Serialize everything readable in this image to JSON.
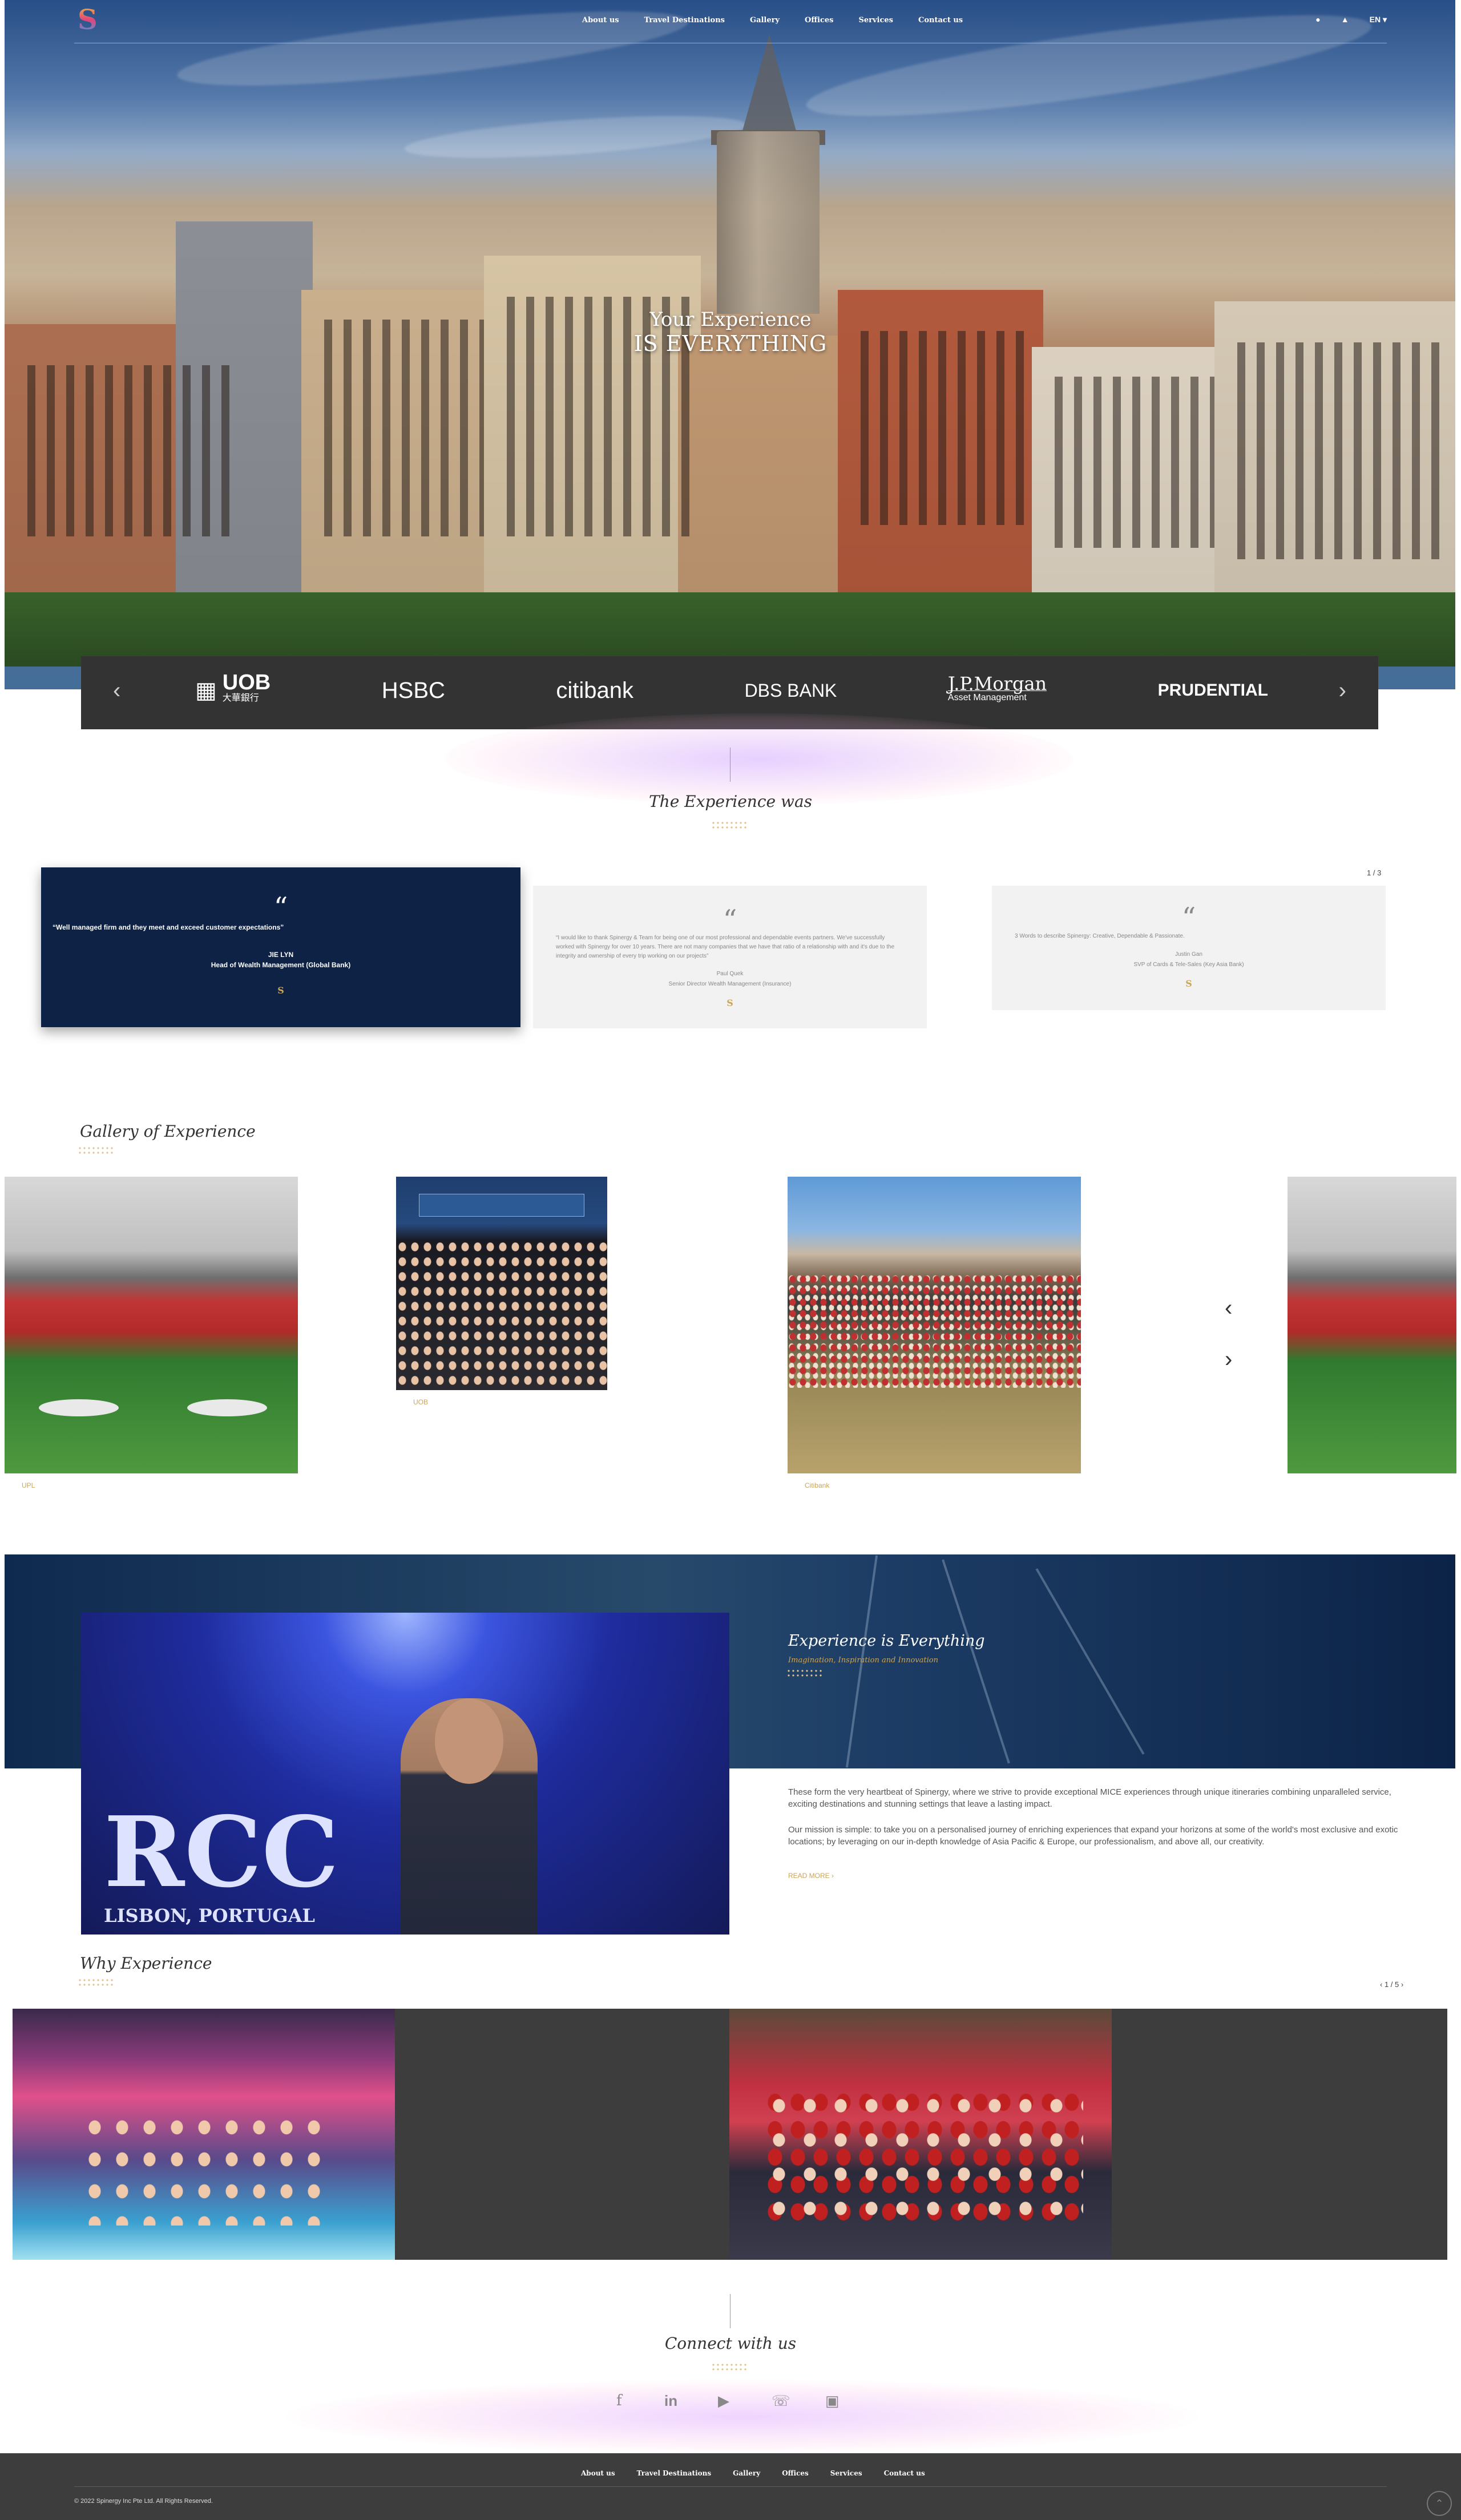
{
  "nav": {
    "menu": [
      "About us",
      "Travel Destinations",
      "Gallery",
      "Offices",
      "Services",
      "Contact us"
    ],
    "lang": "EN"
  },
  "hero": {
    "line1": "Your Experience",
    "line2": "IS EVERYTHING"
  },
  "partners": [
    "UOB",
    "HSBC",
    "citibank",
    "DBS BANK",
    "J.P.Morgan",
    "PRUDENTIAL"
  ],
  "partner_subs": {
    "uob": "大華銀行",
    "jpm": "Asset Management"
  },
  "experience": {
    "title": "The Experience was",
    "pager": "1 / 3",
    "cards": [
      {
        "quote": "“Well managed firm and they meet and exceed customer expectations”",
        "name": "JIE LYN",
        "role": "Head of Wealth Management (Global Bank)"
      },
      {
        "quote": "“I would like to thank Spinergy & Team for being one of our most professional and dependable events partners. We've successfully worked with Spinergy for over 10 years. There are not many companies that we have that ratio of a relationship with and it's due to the integrity and ownership of every trip working on our projects”",
        "name": "Paul Quek",
        "role": "Senior Director Wealth Management (Insurance)"
      },
      {
        "quote": "3 Words to describe Spinergy: Creative, Dependable & Passionate.",
        "name": "Justin Gan",
        "role": "SVP of Cards & Tele-Sales (Key Asia Bank)"
      }
    ]
  },
  "gallery": {
    "title": "Gallery of Experience",
    "captions": [
      "UPL",
      "UOB",
      "Citibank"
    ]
  },
  "about": {
    "title": "Experience is Everything",
    "subtitle": "Imagination, Inspiration and Innovation",
    "rcc_line1": "RCC",
    "rcc_line2": "LISBON, PORTUGAL",
    "p1": "These form the very heartbeat of Spinergy, where we strive to provide exceptional MICE experiences through unique itineraries combining unparalleled service, exciting destinations and stunning settings that leave a lasting impact.",
    "p2": "Our mission is simple: to take you on a personalised journey of enriching experiences that expand your horizons at some of the world's most exclusive and exotic locations; by leveraging on our in-depth knowledge of Asia Pacific & Europe, our professionalism, and above all, our creativity.",
    "read_more": "READ MORE"
  },
  "why": {
    "title": "Why Experience",
    "pager": "1 / 5"
  },
  "connect": {
    "title": "Connect with us",
    "icons": [
      "facebook-icon",
      "linkedin-icon",
      "youtube-icon",
      "whatsapp-icon",
      "instagram-icon"
    ]
  },
  "footer": {
    "menu": [
      "About us",
      "Travel Destinations",
      "Gallery",
      "Offices",
      "Services",
      "Contact us"
    ],
    "copyright": "© 2022 Spinergy Inc Pte Ltd. All Rights Reserved."
  },
  "colors": {
    "navy": "#0d2244",
    "gold": "#c9a55a",
    "dark": "#3d3d3d"
  }
}
